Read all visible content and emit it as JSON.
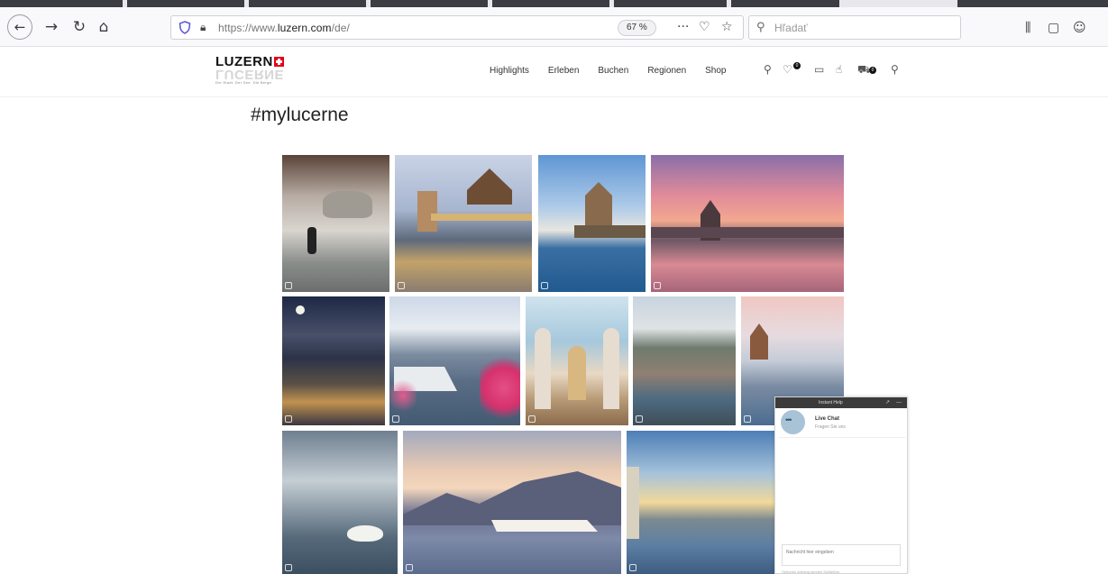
{
  "browser": {
    "url_prefix": "https://www.",
    "url_domain": "luzern.com",
    "url_suffix": "/de/",
    "zoom": "67 %",
    "search_placeholder": "Hľadať",
    "icons": [
      "back-arrow-icon",
      "forward-arrow-icon",
      "reload-icon",
      "home-icon",
      "shield-icon",
      "lock-icon",
      "more-icon",
      "pocket-icon",
      "star-icon",
      "search-icon",
      "library-icon",
      "sidebar-icon",
      "account-icon"
    ]
  },
  "site": {
    "logo_text": "LUZERN",
    "logo_mirror_text": "LUCERNE",
    "logo_tagline": "Die Stadt. Der See. Die Berge.",
    "nav": [
      "Highlights",
      "Erleben",
      "Buchen",
      "Regionen",
      "Shop"
    ],
    "header_icons": [
      "location-pin-icon",
      "heart-icon",
      "video-camera-icon",
      "hand-icon",
      "cart-icon",
      "search-icon"
    ],
    "wishlist_count": "0",
    "cart_count": "0"
  },
  "main": {
    "title": "#mylucerne",
    "photos": [
      "lion-monument",
      "chapel-bridge-dusk",
      "chapel-bridge-blue-sky",
      "chapel-bridge-pink-sunset",
      "lucerne-night-moon",
      "steamboat-blossoms",
      "jesuit-church-interior",
      "lucerne-aerial-view",
      "chapel-bridge-winter",
      "swan-on-lake",
      "paddle-steamer-mountains",
      "lakefront-sunset"
    ]
  },
  "chat": {
    "header": "Instant Help",
    "agent_name": "Live Chat",
    "agent_subtitle": "Fragen Sie uns",
    "message_placeholder": "Nachricht hier eingeben",
    "footer": "Optionen   Anhang senden   Schließen"
  }
}
